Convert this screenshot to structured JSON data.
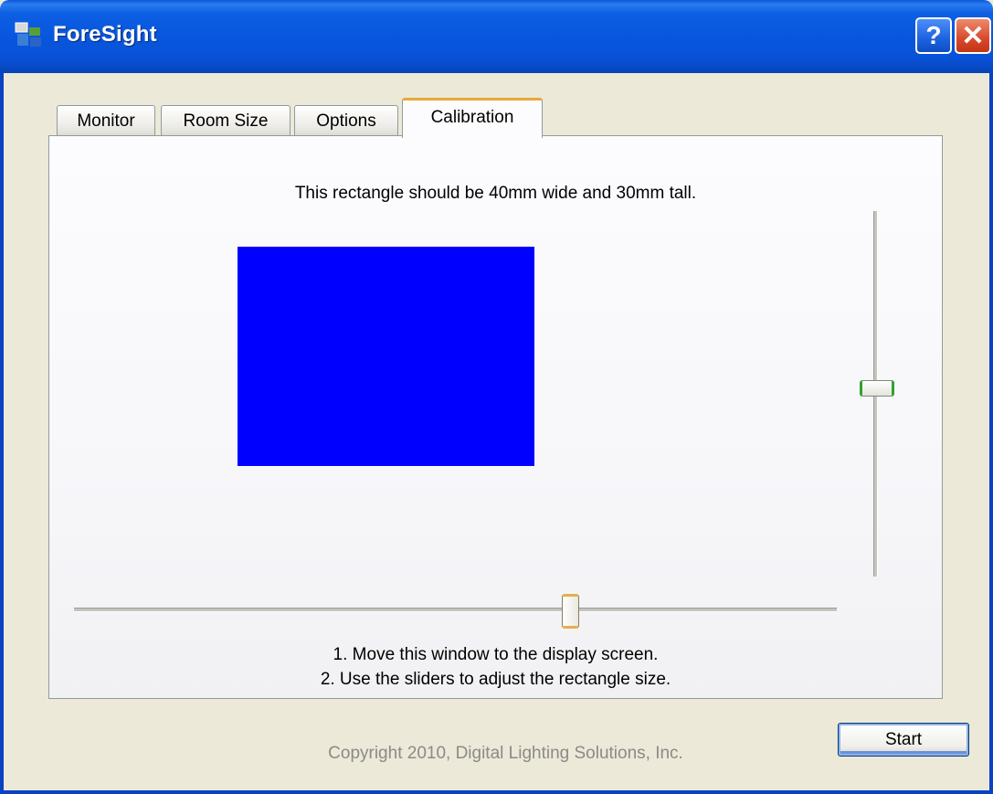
{
  "window": {
    "title": "ForeSight",
    "help_label": "?",
    "close_label": "✕",
    "icon": "foresight-app-icon"
  },
  "tabs": [
    {
      "label": "Monitor",
      "selected": false
    },
    {
      "label": "Room Size",
      "selected": false
    },
    {
      "label": "Options",
      "selected": false
    },
    {
      "label": "Calibration",
      "selected": true
    }
  ],
  "calibration": {
    "instruction": "This rectangle should be 40mm wide and 30mm tall.",
    "rectangle_color": "#0000ff",
    "steps": [
      "1. Move this window to the display screen.",
      "2. Use the sliders to adjust the rectangle size."
    ],
    "vertical_slider_level": 0.48,
    "horizontal_slider_level": 0.65
  },
  "footer": {
    "copyright": "Copyright 2010, Digital Lighting Solutions, Inc.",
    "start_label": "Start"
  },
  "colors": {
    "titlebar": "#0855dd",
    "accent_tab": "#e9a93a",
    "background": "#ece9d8"
  }
}
